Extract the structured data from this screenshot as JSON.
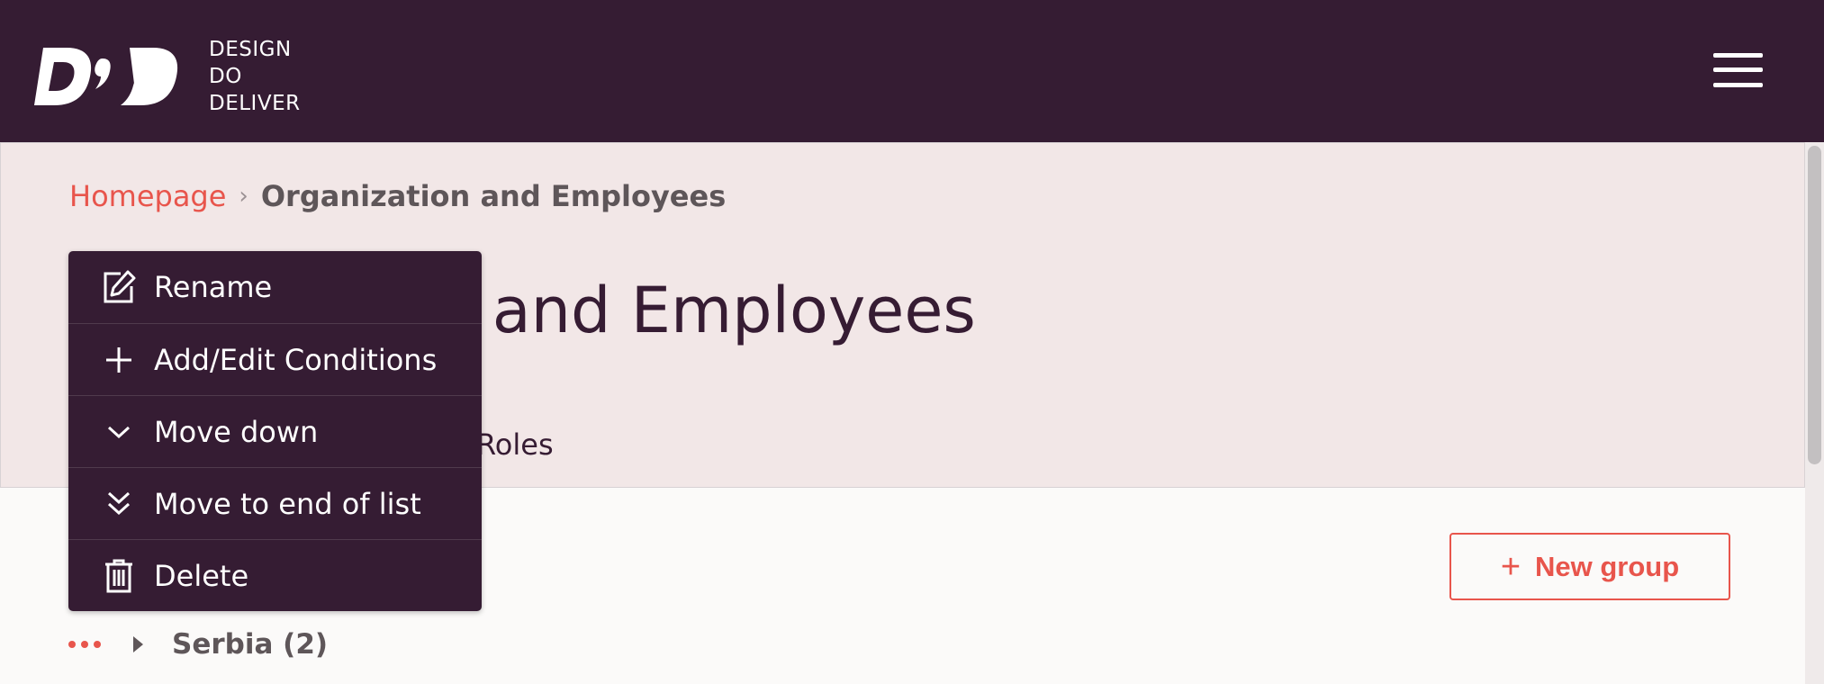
{
  "brand": {
    "line1": "DESIGN",
    "line2": "DO",
    "line3": "DELIVER"
  },
  "breadcrumb": {
    "home": "Homepage",
    "separator": "›",
    "current": "Organization and Employees"
  },
  "page": {
    "title": "Organization and Employees"
  },
  "tabs": [
    {
      "label": "Roles"
    }
  ],
  "context_menu": {
    "items": [
      {
        "label": "Rename",
        "icon": "edit-icon"
      },
      {
        "label": "Add/Edit Conditions",
        "icon": "plus-icon"
      },
      {
        "label": "Move down",
        "icon": "chevron-down-icon"
      },
      {
        "label": "Move to end of list",
        "icon": "double-chevron-down-icon"
      },
      {
        "label": "Delete",
        "icon": "trash-icon"
      }
    ]
  },
  "actions": {
    "new_group": "New group",
    "new_group_icon": "+"
  },
  "groups": [
    {
      "label": "Serbia (2)"
    }
  ],
  "colors": {
    "header_bg": "#351c33",
    "hero_bg": "#f2e7e7",
    "accent": "#e8554c",
    "menu_bg": "#351c33",
    "text_dark": "#361c33",
    "text_muted": "#5e5659"
  }
}
